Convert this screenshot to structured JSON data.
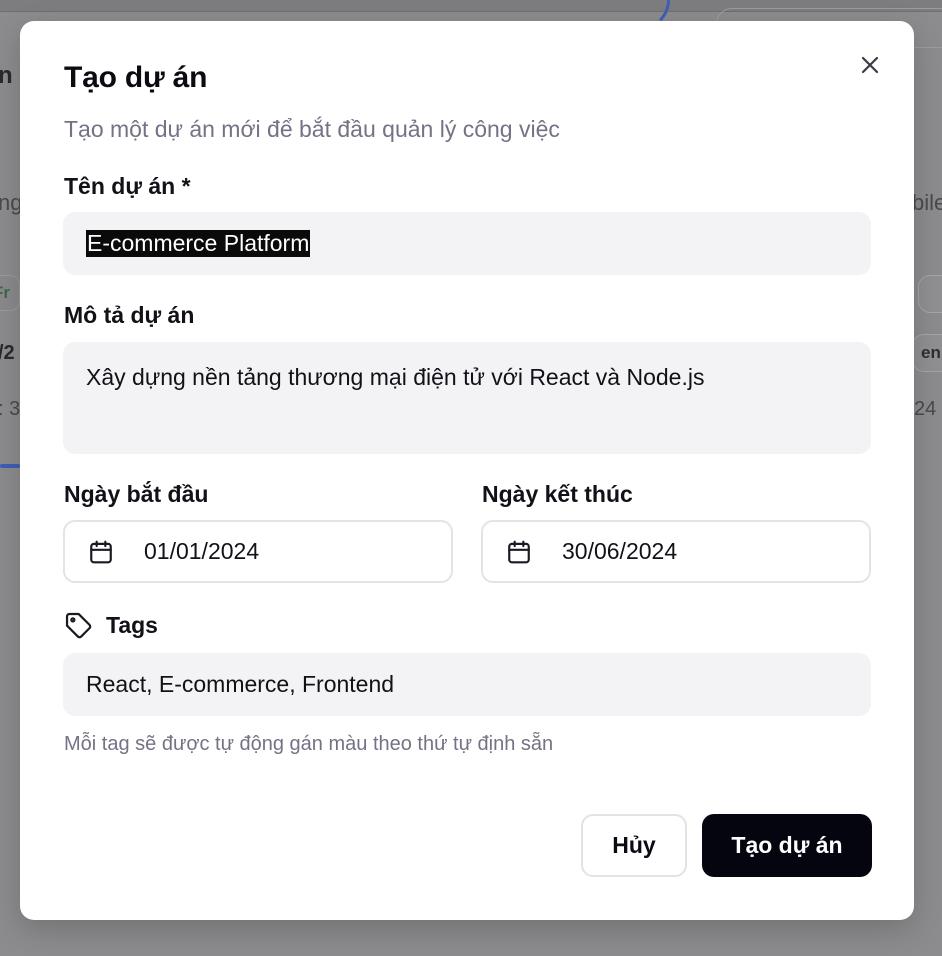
{
  "background": {
    "fragments": [
      "n",
      "ng",
      "Fr",
      "/2",
      ": 3",
      "bile",
      "en",
      "24"
    ]
  },
  "modal": {
    "title": "Tạo dự án",
    "subtitle": "Tạo một dự án mới để bắt đầu quản lý công việc",
    "close_icon": "close-icon"
  },
  "form": {
    "name": {
      "label": "Tên dự án *",
      "value": "E-commerce Platform"
    },
    "description": {
      "label": "Mô tả dự án",
      "value": "Xây dựng nền tảng thương mại điện tử với React và Node.js"
    },
    "start_date": {
      "label": "Ngày bắt đầu",
      "value": "01/01/2024",
      "icon": "calendar-icon"
    },
    "end_date": {
      "label": "Ngày kết thúc",
      "value": "30/06/2024",
      "icon": "calendar-icon"
    },
    "tags": {
      "label": "Tags",
      "icon": "tag-icon",
      "value": "React, E-commerce, Frontend",
      "hint": "Mỗi tag sẽ được tự động gán màu theo thứ tự định sẵn"
    }
  },
  "actions": {
    "cancel_label": "Hủy",
    "create_label": "Tạo dự án"
  },
  "colors": {
    "primary_button": "#05050f",
    "input_bg": "#f3f3f5",
    "muted_text": "#737385",
    "overlay": "#8c8c8e"
  }
}
